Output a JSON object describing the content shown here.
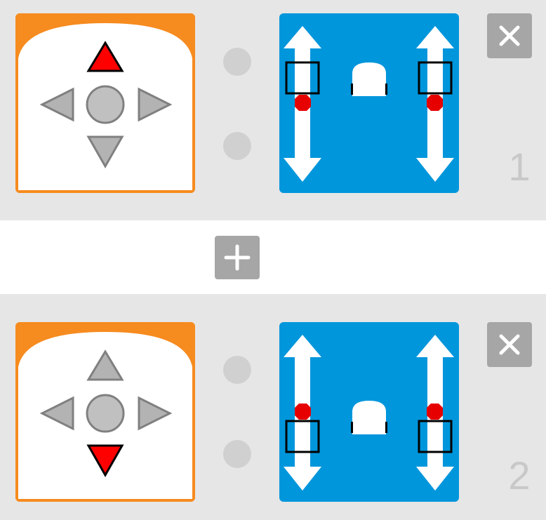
{
  "colors": {
    "event_frame": "#f68b1f",
    "action_background": "#0096dc",
    "active_arrow": "#ff0000",
    "inactive_arrow": "#b3b3b3",
    "button_gray": "#a6a6a6",
    "connector": "#d0d0d0",
    "row_background": "#e6e6e6"
  },
  "rules": [
    {
      "number": "1",
      "event": {
        "icon": "dpad-icon",
        "active_direction": "up"
      },
      "action": {
        "icon": "robot-motors-icon",
        "motion": "forward"
      },
      "delete_icon": "close-icon"
    },
    {
      "number": "2",
      "event": {
        "icon": "dpad-icon",
        "active_direction": "down"
      },
      "action": {
        "icon": "robot-motors-icon",
        "motion": "backward"
      },
      "delete_icon": "close-icon"
    }
  ],
  "add_rule": {
    "icon": "plus-icon"
  }
}
